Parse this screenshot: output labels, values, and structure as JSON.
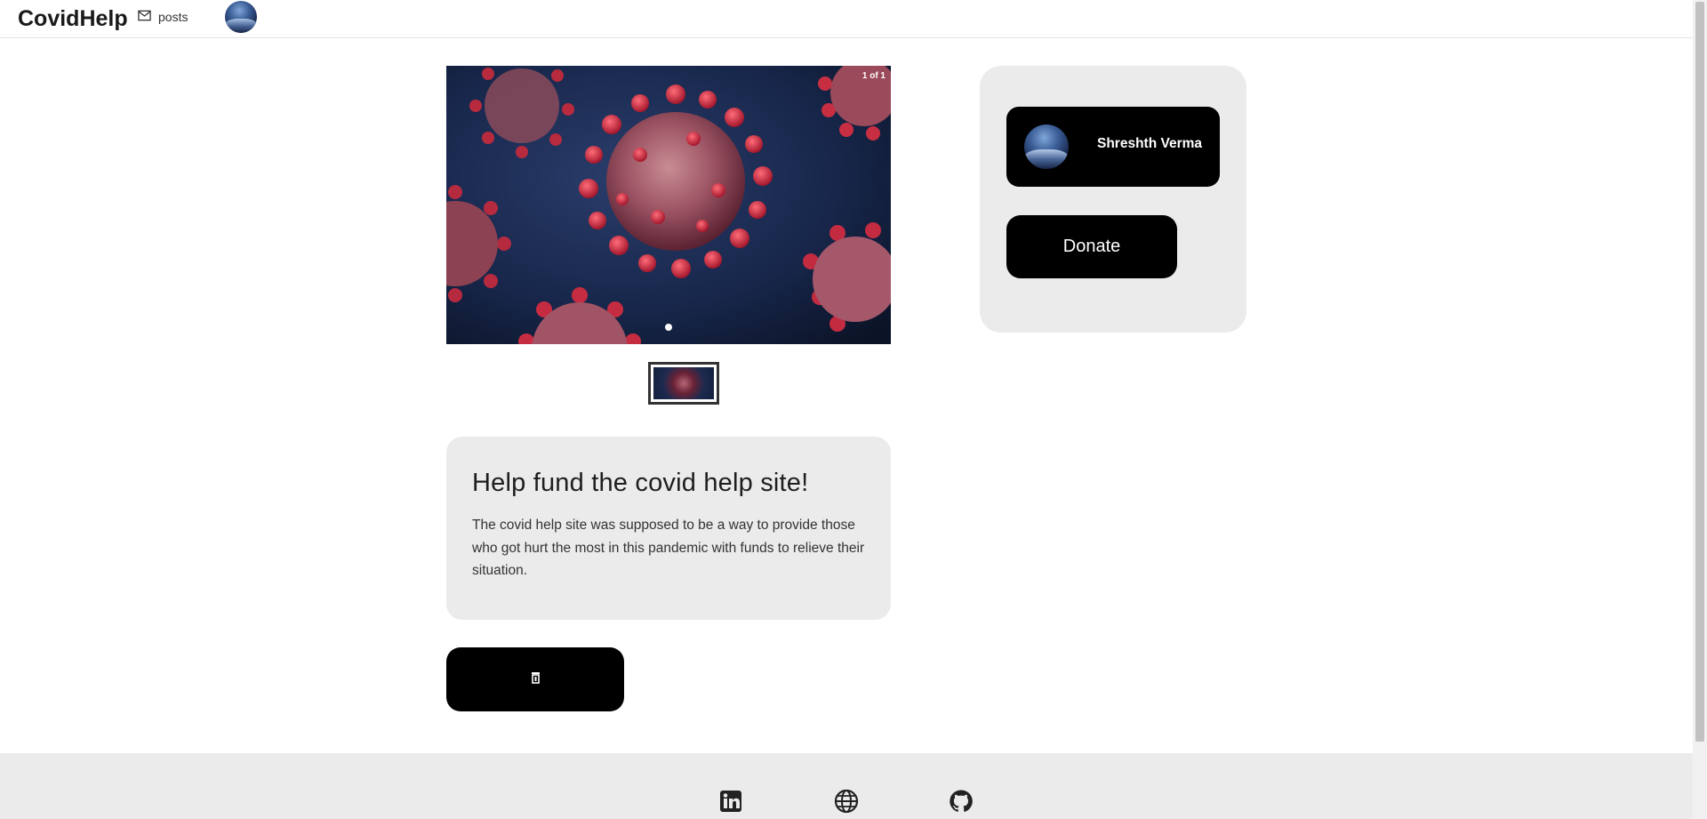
{
  "navbar": {
    "brand": "CovidHelp",
    "posts_label": "posts",
    "mail_icon": "mail-icon",
    "avatar": "user-avatar"
  },
  "carousel": {
    "counter": "1 of 1",
    "slide_count": 1,
    "active_slide": 1
  },
  "post": {
    "title": "Help fund the covid help site!",
    "description": "The covid help site was supposed to be a way to provide those who got hurt the most in this pandemic with funds to relieve their situation.",
    "delete_icon": "trash-icon"
  },
  "sidebar": {
    "author_name": "Shreshth Verma",
    "donate_label": "Donate"
  },
  "footer": {
    "icons": [
      "linkedin-icon",
      "globe-icon",
      "github-icon"
    ]
  },
  "colors": {
    "accent": "#000000",
    "card_bg": "#ebebeb",
    "text": "#222222"
  }
}
